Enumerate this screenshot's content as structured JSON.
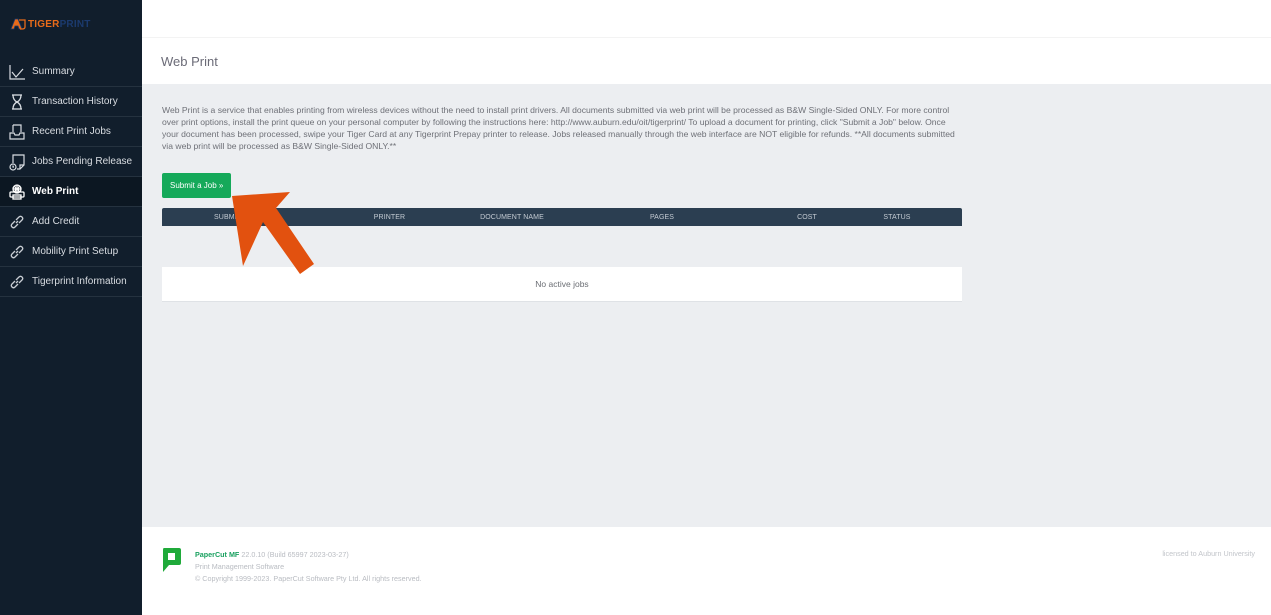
{
  "brand": {
    "logo_part1": "TIGER",
    "logo_part2": "PRINT",
    "colors": {
      "tiger": "#e86b1a",
      "print": "#1b3a6e",
      "sidebar_bg": "#111e2c",
      "accent_green": "#15a95a",
      "table_header": "#2b3e51"
    }
  },
  "sidebar": {
    "items": [
      {
        "label": "Summary",
        "icon": "line-chart-icon",
        "active": false
      },
      {
        "label": "Transaction History",
        "icon": "hourglass-icon",
        "active": false
      },
      {
        "label": "Recent Print Jobs",
        "icon": "inbox-tray-icon",
        "active": false
      },
      {
        "label": "Jobs Pending Release",
        "icon": "pending-document-icon",
        "active": false
      },
      {
        "label": "Web Print",
        "icon": "web-printer-icon",
        "active": true
      },
      {
        "label": "Add Credit",
        "icon": "link-icon",
        "active": false
      },
      {
        "label": "Mobility Print Setup",
        "icon": "link-icon",
        "active": false
      },
      {
        "label": "Tigerprint Information",
        "icon": "link-icon",
        "active": false
      }
    ]
  },
  "page": {
    "title": "Web Print",
    "intro": "Web Print is a service that enables printing from wireless devices without the need to install print drivers. All documents submitted via web print will be processed as B&W Single-Sided ONLY. For more control over print options, install the print queue on your personal computer by following the instructions here: http://www.auburn.edu/oit/tigerprint/ To upload a document for printing, click \"Submit a Job\" below. Once your document has been processed, swipe your Tiger Card at any Tigerprint Prepay printer to release. Jobs released manually through the web interface are NOT eligible for refunds. **All documents submitted via web print will be processed as B&W Single-Sided ONLY.**",
    "submit_button": "Submit a Job »"
  },
  "jobs_table": {
    "columns": [
      "Submit Time",
      "Printer",
      "Document Name",
      "Pages",
      "Cost",
      "Status"
    ],
    "rows": [],
    "empty_message": "No active jobs"
  },
  "footer": {
    "product": "PaperCut MF",
    "version": "22.0.10 (Build 65997 2023-03-27)",
    "tagline": "Print Management Software",
    "copyright": "© Copyright 1999-2023. PaperCut Software Pty Ltd. All rights reserved.",
    "license": "licensed to Auburn University"
  }
}
